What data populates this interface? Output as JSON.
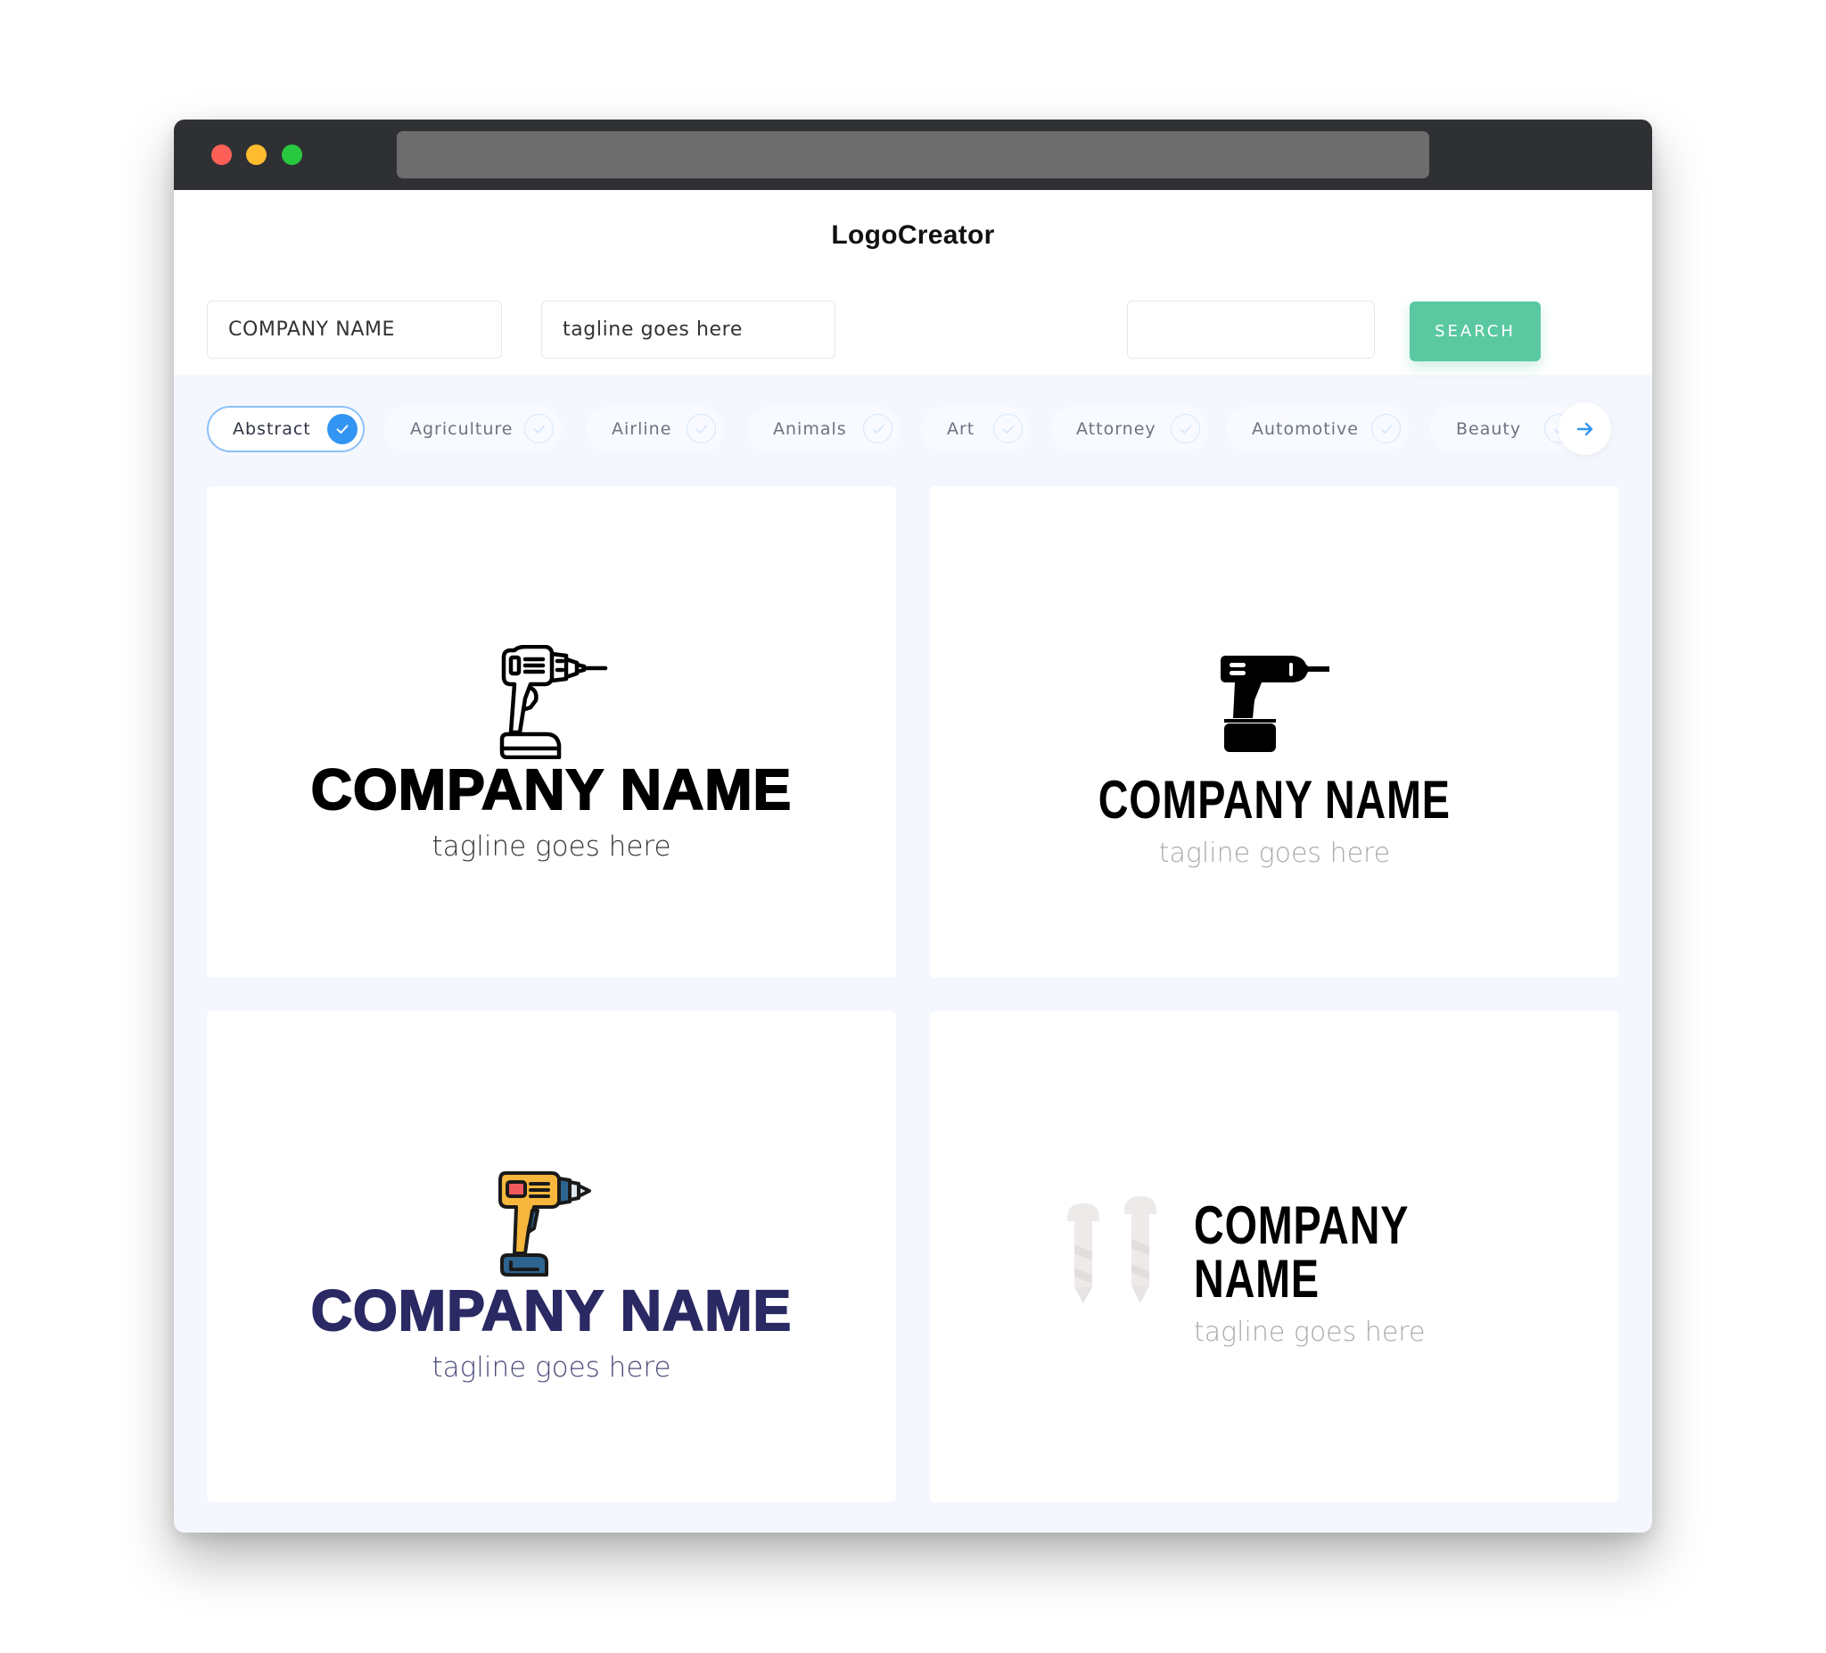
{
  "window": {
    "title": "LogoCreator",
    "traffic_lights": [
      "close",
      "minimize",
      "maximize"
    ]
  },
  "search": {
    "company_name_value": "COMPANY NAME",
    "tagline_value": "tagline goes here",
    "keyword_value": "",
    "button_label": "SEARCH",
    "accent_color": "#5ac8a0"
  },
  "categories": {
    "items": [
      {
        "label": "Abstract",
        "selected": true
      },
      {
        "label": "Agriculture",
        "selected": false
      },
      {
        "label": "Airline",
        "selected": false
      },
      {
        "label": "Animals",
        "selected": false
      },
      {
        "label": "Art",
        "selected": false
      },
      {
        "label": "Attorney",
        "selected": false
      },
      {
        "label": "Automotive",
        "selected": false
      },
      {
        "label": "Beauty",
        "selected": false
      }
    ],
    "next_icon": "arrow-right-icon",
    "selected_color": "#3395f3"
  },
  "logos": [
    {
      "icon": "drill-outline-icon",
      "company": "COMPANY NAME",
      "tagline": "tagline goes here",
      "text_color": "#000000"
    },
    {
      "icon": "drill-solid-icon",
      "company": "COMPANY NAME",
      "tagline": "tagline goes here",
      "text_color": "#000000"
    },
    {
      "icon": "drill-color-icon",
      "company": "COMPANY NAME",
      "tagline": "tagline goes here",
      "text_color": "#2a2963"
    },
    {
      "icon": "screws-icon",
      "company": "COMPANY NAME",
      "tagline": "tagline goes here",
      "text_color": "#000000"
    }
  ]
}
